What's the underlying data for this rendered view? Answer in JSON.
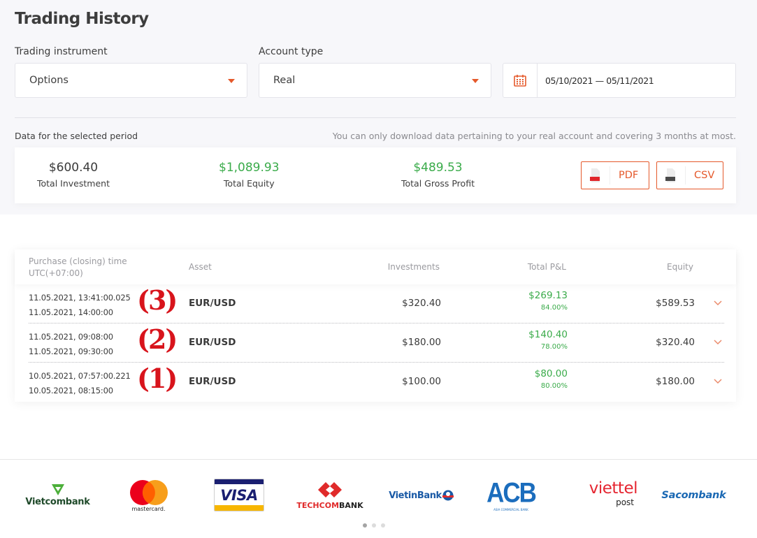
{
  "page": {
    "title": "Trading History"
  },
  "filters": {
    "instrument": {
      "label": "Trading instrument",
      "value": "Options"
    },
    "account": {
      "label": "Account type",
      "value": "Real"
    },
    "date_range": {
      "icon": "calendar-icon",
      "value": "05/10/2021 — 05/11/2021"
    }
  },
  "summary": {
    "period_label": "Data for the selected period",
    "note": "You can only download data pertaining to your real account and covering 3 months at most.",
    "items": [
      {
        "value": "$600.40",
        "label": "Total Investment"
      },
      {
        "value": "$1,089.93",
        "label": "Total Equity"
      },
      {
        "value": "$489.53",
        "label": "Total Gross Profit"
      }
    ],
    "downloads": [
      {
        "label": "PDF",
        "icon": "pdf-file-icon",
        "badge": "PDF"
      },
      {
        "label": "CSV",
        "icon": "csv-file-icon",
        "badge": "CSV"
      }
    ]
  },
  "table": {
    "headers": {
      "time_line1": "Purchase (closing) time",
      "time_line2": "UTC(+07:00)",
      "asset": "Asset",
      "investments": "Investments",
      "pl": "Total P&L",
      "equity": "Equity"
    },
    "rows": [
      {
        "marker": "(3)",
        "open": "11.05.2021, 13:41:00.025",
        "close": "11.05.2021, 14:00:00",
        "asset": "EUR/USD",
        "investment": "$320.40",
        "pl": "$269.13",
        "pl_pct": "84.00%",
        "equity": "$589.53"
      },
      {
        "marker": "(2)",
        "open": "11.05.2021, 09:08:00",
        "close": "11.05.2021, 09:30:00",
        "asset": "EUR/USD",
        "investment": "$180.00",
        "pl": "$140.40",
        "pl_pct": "78.00%",
        "equity": "$320.40"
      },
      {
        "marker": "(1)",
        "open": "10.05.2021, 07:57:00.221",
        "close": "10.05.2021, 08:15:00",
        "asset": "EUR/USD",
        "investment": "$100.00",
        "pl": "$80.00",
        "pl_pct": "80.00%",
        "equity": "$180.00"
      }
    ]
  },
  "payment_logos": [
    {
      "name": "Vietcombank",
      "text": "Vietcombank"
    },
    {
      "name": "Mastercard",
      "text": "mastercard."
    },
    {
      "name": "Visa",
      "text": "VISA"
    },
    {
      "name": "Techcombank",
      "text_red": "TECHCOM",
      "text_dark": "BANK"
    },
    {
      "name": "VietinBank",
      "text": "VietinBank"
    },
    {
      "name": "ACB",
      "text": "ACB",
      "subtext": "ASIA COMMERCIAL BANK"
    },
    {
      "name": "Viettel Post",
      "text": "viettel",
      "subtext": "post"
    },
    {
      "name": "Sacombank",
      "text": "Sacombank"
    }
  ],
  "carousel": {
    "pages": 3,
    "active": 1
  },
  "colors": {
    "accent": "#e5592b",
    "positive": "#3aab4a",
    "marker": "#d8141c"
  }
}
